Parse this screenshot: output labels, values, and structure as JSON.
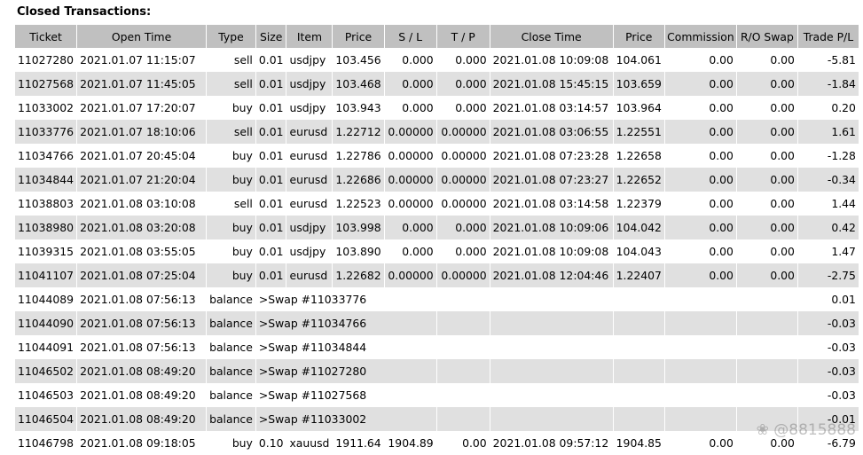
{
  "title": "Closed Transactions:",
  "columns": [
    "Ticket",
    "Open Time",
    "Type",
    "Size",
    "Item",
    "Price",
    "S / L",
    "T / P",
    "Close Time",
    "Price",
    "Commission",
    "R/O Swap",
    "Trade P/L"
  ],
  "rows": [
    {
      "ticket": "11027280",
      "open_time": "2021.01.07 11:15:07",
      "type": "sell",
      "size": "0.01",
      "item": "usdjpy",
      "price": "103.456",
      "sl": "0.000",
      "tp": "0.000",
      "close_time": "2021.01.08 10:09:08",
      "close_price": "104.061",
      "commission": "0.00",
      "swap": "0.00",
      "pl": "-5.81"
    },
    {
      "ticket": "11027568",
      "open_time": "2021.01.07 11:45:05",
      "type": "sell",
      "size": "0.01",
      "item": "usdjpy",
      "price": "103.468",
      "sl": "0.000",
      "tp": "0.000",
      "close_time": "2021.01.08 15:45:15",
      "close_price": "103.659",
      "commission": "0.00",
      "swap": "0.00",
      "pl": "-1.84"
    },
    {
      "ticket": "11033002",
      "open_time": "2021.01.07 17:20:07",
      "type": "buy",
      "size": "0.01",
      "item": "usdjpy",
      "price": "103.943",
      "sl": "0.000",
      "tp": "0.000",
      "close_time": "2021.01.08 03:14:57",
      "close_price": "103.964",
      "commission": "0.00",
      "swap": "0.00",
      "pl": "0.20"
    },
    {
      "ticket": "11033776",
      "open_time": "2021.01.07 18:10:06",
      "type": "sell",
      "size": "0.01",
      "item": "eurusd",
      "price": "1.22712",
      "sl": "0.00000",
      "tp": "0.00000",
      "close_time": "2021.01.08 03:06:55",
      "close_price": "1.22551",
      "commission": "0.00",
      "swap": "0.00",
      "pl": "1.61"
    },
    {
      "ticket": "11034766",
      "open_time": "2021.01.07 20:45:04",
      "type": "buy",
      "size": "0.01",
      "item": "eurusd",
      "price": "1.22786",
      "sl": "0.00000",
      "tp": "0.00000",
      "close_time": "2021.01.08 07:23:28",
      "close_price": "1.22658",
      "commission": "0.00",
      "swap": "0.00",
      "pl": "-1.28"
    },
    {
      "ticket": "11034844",
      "open_time": "2021.01.07 21:20:04",
      "type": "buy",
      "size": "0.01",
      "item": "eurusd",
      "price": "1.22686",
      "sl": "0.00000",
      "tp": "0.00000",
      "close_time": "2021.01.08 07:23:27",
      "close_price": "1.22652",
      "commission": "0.00",
      "swap": "0.00",
      "pl": "-0.34"
    },
    {
      "ticket": "11038803",
      "open_time": "2021.01.08 03:10:08",
      "type": "sell",
      "size": "0.01",
      "item": "eurusd",
      "price": "1.22523",
      "sl": "0.00000",
      "tp": "0.00000",
      "close_time": "2021.01.08 03:14:58",
      "close_price": "1.22379",
      "commission": "0.00",
      "swap": "0.00",
      "pl": "1.44"
    },
    {
      "ticket": "11038980",
      "open_time": "2021.01.08 03:20:08",
      "type": "buy",
      "size": "0.01",
      "item": "usdjpy",
      "price": "103.998",
      "sl": "0.000",
      "tp": "0.000",
      "close_time": "2021.01.08 10:09:06",
      "close_price": "104.042",
      "commission": "0.00",
      "swap": "0.00",
      "pl": "0.42"
    },
    {
      "ticket": "11039315",
      "open_time": "2021.01.08 03:55:05",
      "type": "buy",
      "size": "0.01",
      "item": "usdjpy",
      "price": "103.890",
      "sl": "0.000",
      "tp": "0.000",
      "close_time": "2021.01.08 10:09:08",
      "close_price": "104.043",
      "commission": "0.00",
      "swap": "0.00",
      "pl": "1.47"
    },
    {
      "ticket": "11041107",
      "open_time": "2021.01.08 07:25:04",
      "type": "buy",
      "size": "0.01",
      "item": "eurusd",
      "price": "1.22682",
      "sl": "0.00000",
      "tp": "0.00000",
      "close_time": "2021.01.08 12:04:46",
      "close_price": "1.22407",
      "commission": "0.00",
      "swap": "0.00",
      "pl": "-2.75"
    },
    {
      "ticket": "11044089",
      "open_time": "2021.01.08 07:56:13",
      "type": "balance",
      "note": ">Swap #11033776",
      "pl": "0.01"
    },
    {
      "ticket": "11044090",
      "open_time": "2021.01.08 07:56:13",
      "type": "balance",
      "note": ">Swap #11034766",
      "pl": "-0.03"
    },
    {
      "ticket": "11044091",
      "open_time": "2021.01.08 07:56:13",
      "type": "balance",
      "note": ">Swap #11034844",
      "pl": "-0.03"
    },
    {
      "ticket": "11046502",
      "open_time": "2021.01.08 08:49:20",
      "type": "balance",
      "note": ">Swap #11027280",
      "pl": "-0.03"
    },
    {
      "ticket": "11046503",
      "open_time": "2021.01.08 08:49:20",
      "type": "balance",
      "note": ">Swap #11027568",
      "pl": "-0.03"
    },
    {
      "ticket": "11046504",
      "open_time": "2021.01.08 08:49:20",
      "type": "balance",
      "note": ">Swap #11033002",
      "pl": "-0.01"
    },
    {
      "ticket": "11046798",
      "open_time": "2021.01.08 09:18:05",
      "type": "buy",
      "size": "0.10",
      "item": "xauusd",
      "price": "1911.64",
      "sl": "1904.89",
      "tp": "0.00",
      "close_time": "2021.01.08 09:57:12",
      "close_price": "1904.85",
      "commission": "0.00",
      "swap": "0.00",
      "pl": "-6.79"
    }
  ],
  "watermark": "❀ @8815888"
}
